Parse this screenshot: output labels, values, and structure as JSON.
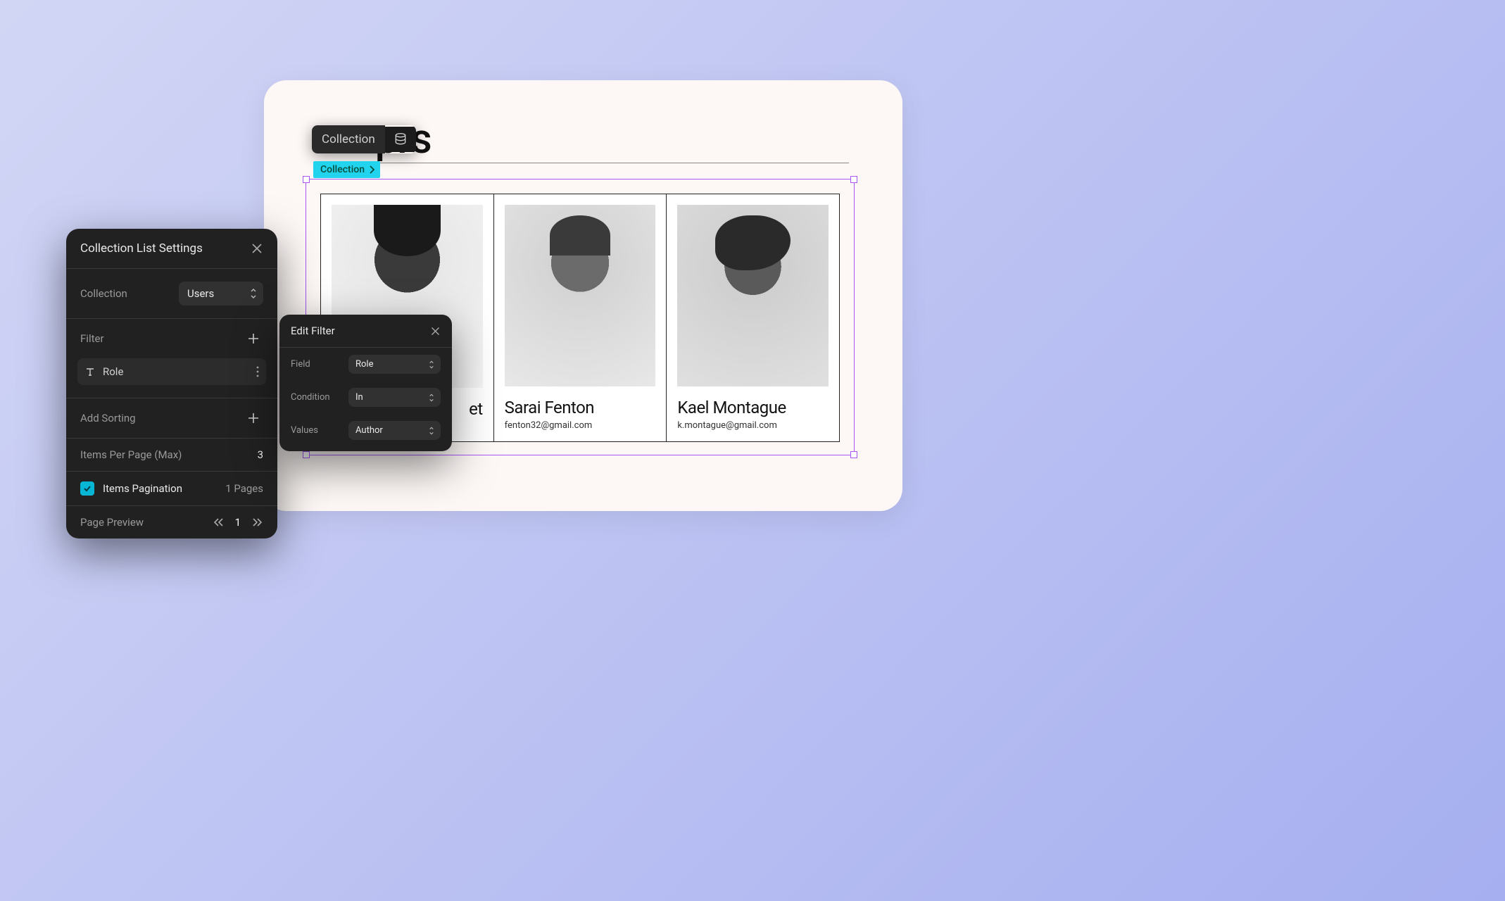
{
  "preview": {
    "page_title_fragment": "prs",
    "element_tag_dark": "Collection",
    "element_tag_cyan": "Collection",
    "cards": [
      {
        "name_fragment": "et",
        "email": ""
      },
      {
        "name": "Sarai Fenton",
        "email": "fenton32@gmail.com"
      },
      {
        "name": "Kael Montague",
        "email": "k.montague@gmail.com"
      }
    ]
  },
  "settings": {
    "title": "Collection List Settings",
    "collection_label": "Collection",
    "collection_value": "Users",
    "filter_label": "Filter",
    "filter_chip_text": "Role",
    "add_sorting_label": "Add Sorting",
    "items_per_page_label": "Items Per Page (Max)",
    "items_per_page_value": "3",
    "pagination_label": "Items Pagination",
    "pagination_pages": "1 Pages",
    "page_preview_label": "Page Preview",
    "page_preview_value": "1"
  },
  "edit_filter": {
    "title": "Edit Filter",
    "field_label": "Field",
    "field_value": "Role",
    "condition_label": "Condition",
    "condition_value": "In",
    "values_label": "Values",
    "values_value": "Author"
  },
  "colors": {
    "accent_cyan": "#22d3ee",
    "selection_purple": "#a855f7"
  }
}
